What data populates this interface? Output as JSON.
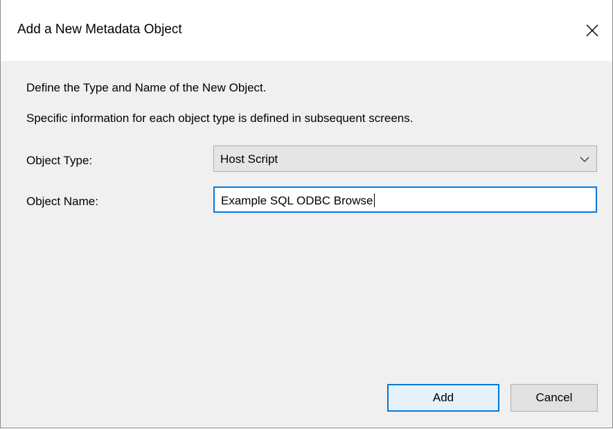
{
  "window": {
    "title": "Add a New Metadata Object",
    "close_icon": "close-icon"
  },
  "content": {
    "description_line1": "Define the Type and Name of the New Object.",
    "description_line2": "Specific information for each object type is defined in subsequent screens."
  },
  "form": {
    "object_type_label": "Object Type:",
    "object_type_value": "Host Script",
    "object_name_label": "Object Name:",
    "object_name_value": "Example SQL ODBC Browse"
  },
  "buttons": {
    "add_label": "Add",
    "cancel_label": "Cancel"
  },
  "colors": {
    "focus_accent": "#0078d7",
    "dialog_background": "#f0f0f0",
    "titlebar_background": "#ffffff"
  }
}
